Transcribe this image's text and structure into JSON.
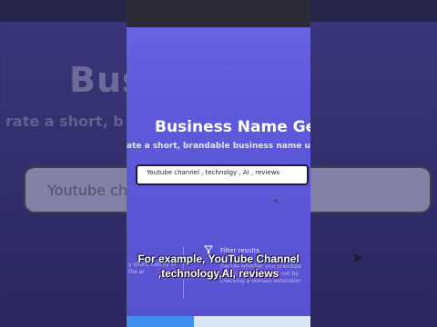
{
  "background": {
    "title_fragment": "Bus        e Gene",
    "subtitle_fragment": "rate a short, b                      name using",
    "input_fragment": "Youtube ch                                    reviews"
  },
  "page": {
    "title": "Business Name Gene",
    "subtitle": "ate a short, brandable business name usin",
    "search_value": "Youtube channel , technolgy , Ai , reviews",
    "filter_label": "Filter results",
    "left_description": "y short, catchy of the ar",
    "right_description": "Decide whether you prioritize domain availability or not by checking a domain extension"
  },
  "caption": {
    "line1": "For example, YouTube Channel",
    "line2": ",technology,AI, reviews"
  },
  "colors": {
    "accent": "#5f5adc",
    "background": "#2f2a6a"
  }
}
